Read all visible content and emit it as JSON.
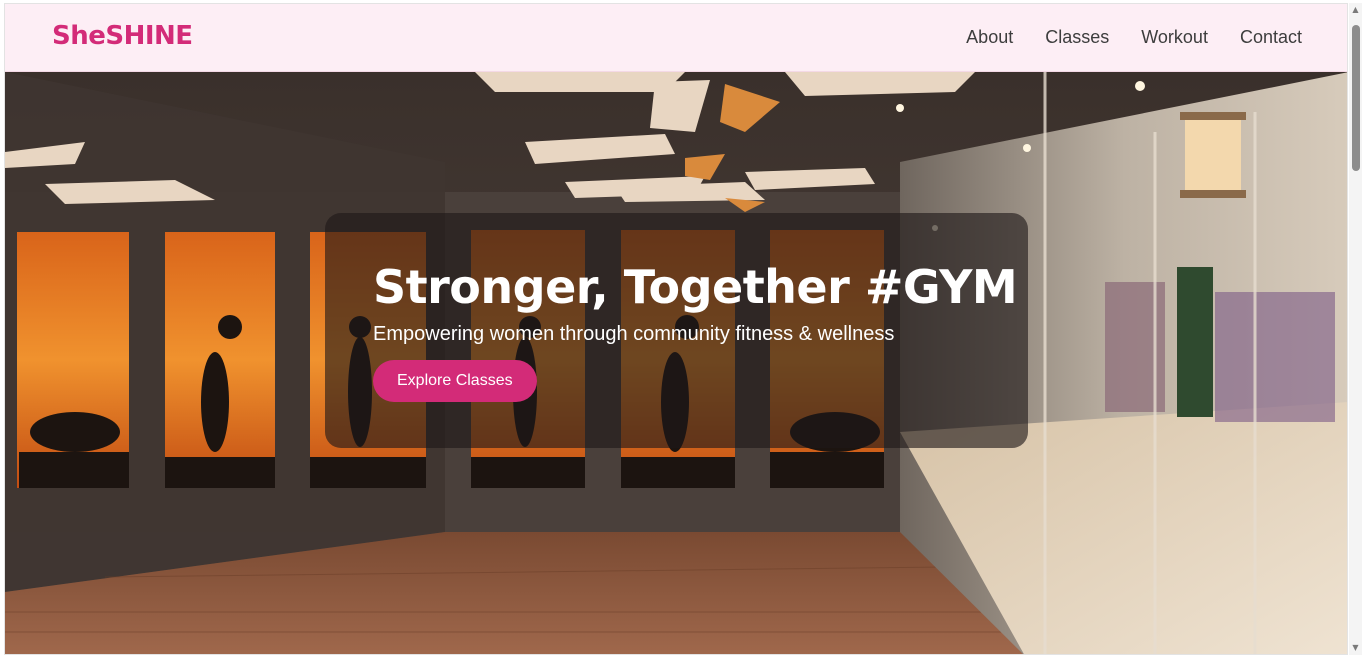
{
  "header": {
    "brand": "SheSHINE",
    "nav": [
      "About",
      "Classes",
      "Workout",
      "Contact"
    ]
  },
  "hero": {
    "title": "Stronger, Together #GYM",
    "subtitle": "Empowering women through community fitness & wellness",
    "cta_label": "Explore Classes"
  },
  "colors": {
    "brand": "#d32b78",
    "header_bg": "#fdeef5",
    "card_bg": "rgba(30,24,24,0.62)"
  },
  "icons": {
    "scroll_up": "triangle-up",
    "scroll_down": "triangle-down"
  }
}
